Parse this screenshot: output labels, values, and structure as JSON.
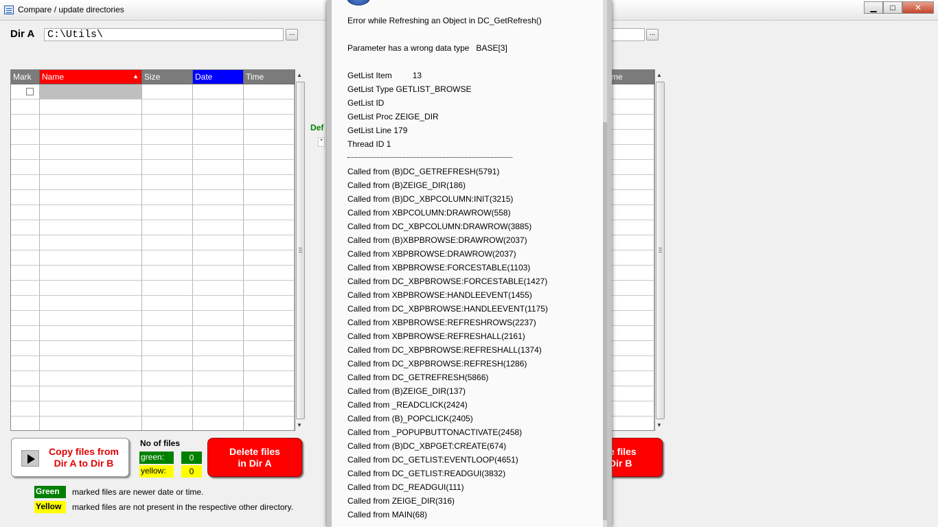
{
  "window": {
    "title": "Compare / update directories",
    "ctrl_minimize": "▁",
    "ctrl_maximize": "□",
    "ctrl_close": "✕"
  },
  "dir_a": {
    "label": "Dir A",
    "path": "C:\\Utils\\",
    "browse_label": "..."
  },
  "dir_b": {
    "browse_label": "..."
  },
  "grid_a": {
    "columns": [
      "Mark",
      "Name",
      "Size",
      "Date",
      "Time"
    ],
    "sort_indicator": "▲"
  },
  "grid_b": {
    "columns": [
      "me"
    ]
  },
  "scroll": {
    "up": "▲",
    "down": "▼"
  },
  "middle": {
    "def_label": "Def",
    "def_mark": "*"
  },
  "copy_button": {
    "line1": "Copy files from",
    "line2": "Dir A to Dir B"
  },
  "counts": {
    "title": "No of files",
    "green_label": "green:",
    "green_value": "0",
    "yellow_label": "yellow:",
    "yellow_value": "0"
  },
  "delete_a": {
    "line1": "Delete files",
    "line2": "in Dir A"
  },
  "delete_b": {
    "line1": "e files",
    "line2": "Dir B"
  },
  "legend": {
    "green_tag": "Green",
    "green_text": "marked files are newer date or time.",
    "yellow_tag": "Yellow",
    "yellow_text": "marked files are not present in the respective other directory."
  },
  "error_dialog": {
    "header_lines": [
      "Error while Refreshing an Object in DC_GetRefresh()",
      "Parameter has a wrong data type   BASE[3]",
      "GetList Item         13",
      "GetList Type GETLIST_BROWSE",
      "GetList ID",
      "GetList Proc ZEIGE_DIR",
      "GetList Line 179",
      "Thread ID 1"
    ],
    "call_stack": [
      "Called from (B)DC_GETREFRESH(5791)",
      "Called from (B)ZEIGE_DIR(186)",
      "Called from (B)DC_XBPCOLUMN:INIT(3215)",
      "Called from XBPCOLUMN:DRAWROW(558)",
      "Called from DC_XBPCOLUMN:DRAWROW(3885)",
      "Called from (B)XBPBROWSE:DRAWROW(2037)",
      "Called from XBPBROWSE:DRAWROW(2037)",
      "Called from XBPBROWSE:FORCESTABLE(1103)",
      "Called from DC_XBPBROWSE:FORCESTABLE(1427)",
      "Called from XBPBROWSE:HANDLEEVENT(1455)",
      "Called from DC_XBPBROWSE:HANDLEEVENT(1175)",
      "Called from XBPBROWSE:REFRESHROWS(2237)",
      "Called from XBPBROWSE:REFRESHALL(2161)",
      "Called from DC_XBPBROWSE:REFRESHALL(1374)",
      "Called from DC_XBPBROWSE:REFRESH(1286)",
      "Called from DC_GETREFRESH(5866)",
      "Called from (B)ZEIGE_DIR(137)",
      "Called from _READCLICK(2424)",
      "Called from (B)_POPCLICK(2405)",
      "Called from _POPUPBUTTONACTIVATE(2458)",
      "Called from (B)DC_XBPGET:CREATE(674)",
      "Called from DC_GETLIST:EVENTLOOP(4651)",
      "Called from DC_GETLIST:READGUI(3832)",
      "Called from DC_READGUI(111)",
      "Called from ZEIGE_DIR(316)",
      "Called from MAIN(68)"
    ]
  }
}
